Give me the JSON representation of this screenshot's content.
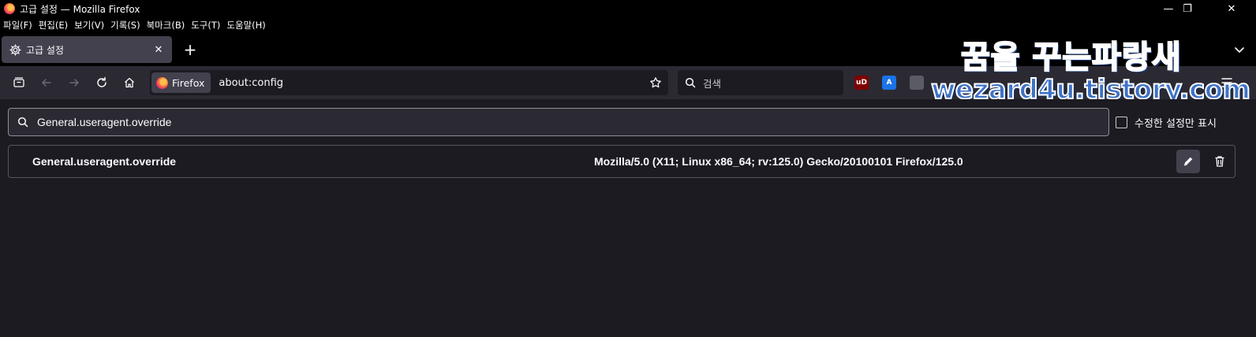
{
  "window": {
    "title": "고급 설정 — Mozilla Firefox",
    "controls": {
      "minimize": "—",
      "maximize": "❐",
      "close": "✕"
    }
  },
  "menu": [
    "파일(F)",
    "편집(E)",
    "보기(V)",
    "기록(S)",
    "북마크(B)",
    "도구(T)",
    "도움말(H)"
  ],
  "tab": {
    "label": "고급 설정",
    "close": "✕"
  },
  "newtab": "+",
  "watermark": {
    "line1": "꿈을 꾸는파랑새",
    "line2": "wezard4u.tistory.com"
  },
  "urlbar": {
    "identity_label": "Firefox",
    "url": "about:config"
  },
  "searchbar": {
    "placeholder": "검색"
  },
  "extensions": [
    {
      "name": "ublock-origin-icon",
      "text": "uD",
      "color": "#800000"
    },
    {
      "name": "translate-extension-icon",
      "text": "A",
      "color": "#1a73e8"
    },
    {
      "name": "puzzle-extension-icon",
      "text": "",
      "color": "#5b5b66"
    }
  ],
  "config": {
    "search_value": "General.useragent.override",
    "modified_only_label": "수정한 설정만 표시",
    "modified_only_checked": false,
    "pref": {
      "name": "General.useragent.override",
      "value": "Mozilla/5.0 (X11; Linux x86_64; rv:125.0) Gecko/20100101 Firefox/125.0"
    }
  },
  "colors": {
    "accent_bg": "#2b2a33",
    "content_bg": "#1c1b22",
    "tab_bg": "#42414d",
    "text": "#fbfbfe"
  }
}
